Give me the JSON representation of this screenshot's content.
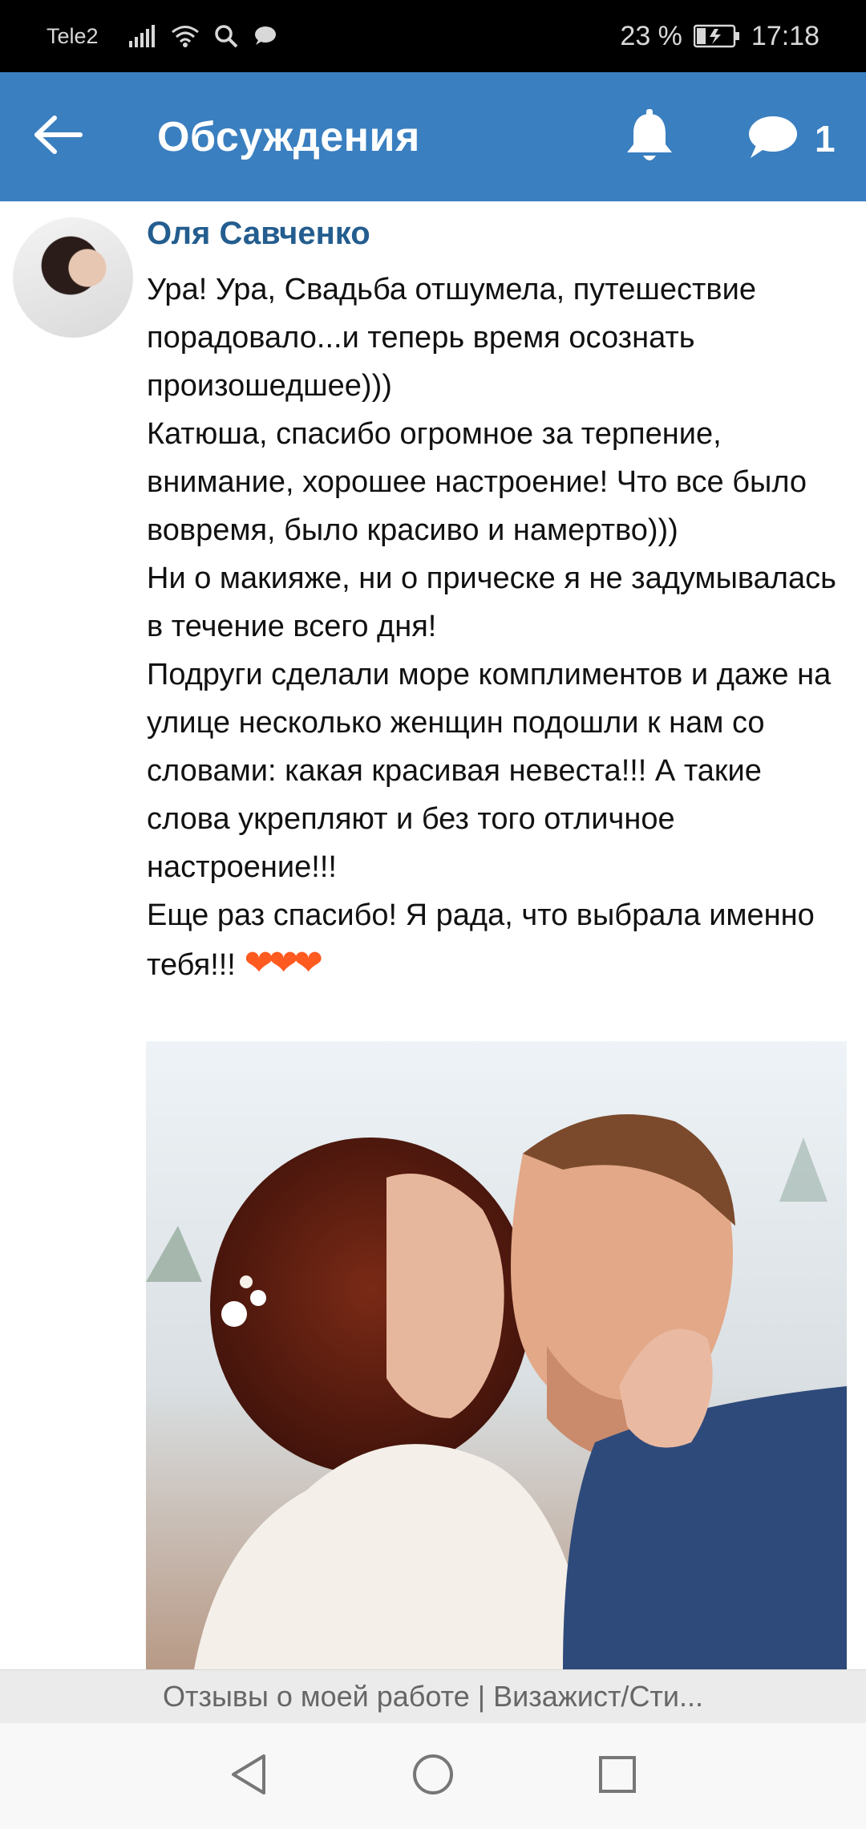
{
  "status_bar": {
    "carrier": "Tele2",
    "battery": "23 %",
    "time": "17:18",
    "icons": [
      "signal-icon",
      "wifi-icon",
      "search-icon",
      "chat-bubble-icon",
      "battery-icon"
    ]
  },
  "header": {
    "title": "Обсуждения",
    "message_count": "1",
    "icons": [
      "arrow-left-icon",
      "bell-icon",
      "chat-bubble-icon"
    ]
  },
  "post": {
    "author": "Оля Савченко",
    "paragraphs": [
      "Ура! Ура, Свадьба отшумела, путешествие порадовало...и теперь время осознать произошедшее)))",
      "Катюша, спасибо огромное за терпение, внимание, хорошее настроение! Что все было вовремя, было красиво и намертво)))",
      "Ни о макияже, ни о прическе я не задумывалась в течение всего дня!",
      "Подруги сделали море комплиментов и даже на улице несколько женщин подошли к нам со словами: какая красивая невеста!!! А такие слова укрепляют и без того отличное настроение!!!",
      "Еще раз спасибо! Я рада, что выбрала именно тебя!!!"
    ],
    "hearts": "❤❤❤"
  },
  "caption_bar": {
    "text": "Отзывы о моей работе | Визажист/Сти..."
  },
  "colors": {
    "app_bar": "#3a7fc0",
    "author": "#245d8f",
    "hearts": "#ff5a1f"
  }
}
